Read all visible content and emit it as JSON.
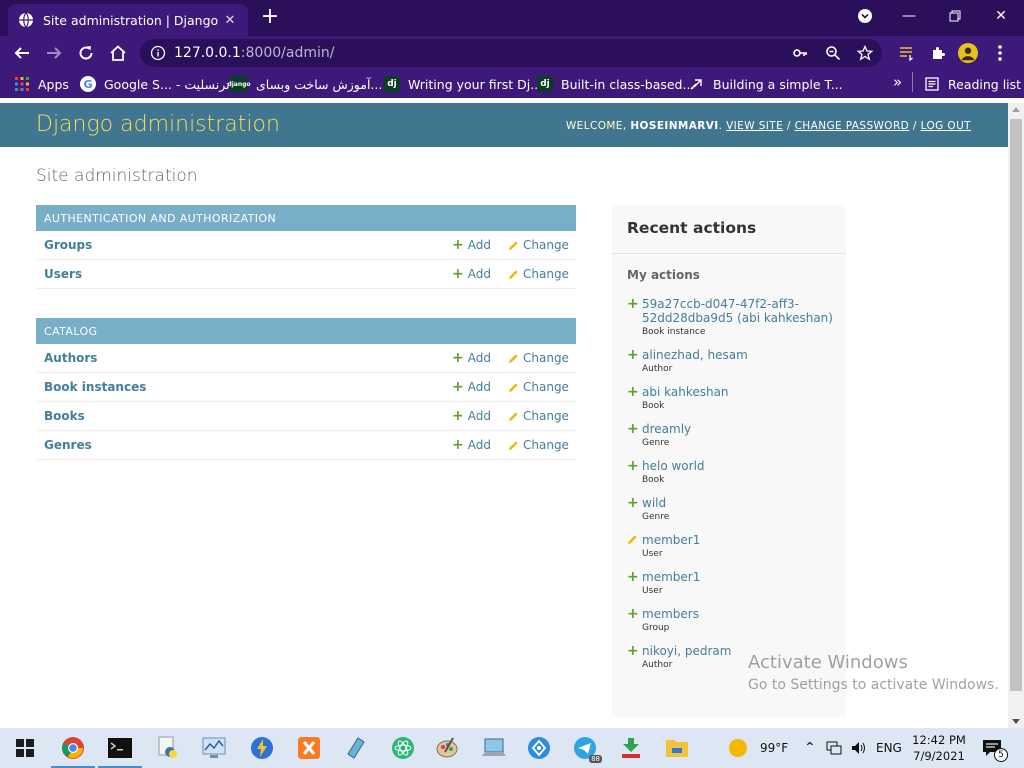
{
  "browser": {
    "tab_title": "Site administration | Django site admin",
    "url_host": "127.0.0.1",
    "url_rest": ":8000/admin/",
    "bookmarks": [
      {
        "label": "Apps",
        "icon": "apps-grid-icon"
      },
      {
        "label": "Google S... - ترنسليت",
        "icon": "google-icon"
      },
      {
        "label": "آموزش ساخت وبسای...",
        "icon": "django-icon"
      },
      {
        "label": "Writing your first Dj...",
        "icon": "dj-icon"
      },
      {
        "label": "Built-in class-based...",
        "icon": "dj-icon"
      },
      {
        "label": "Building a simple T...",
        "icon": "link-icon"
      }
    ],
    "bookmark_more": "»",
    "reading_list": "Reading list"
  },
  "header": {
    "branding": "Django administration",
    "welcome": "WELCOME,",
    "username": "HOSEINMARVI",
    "view_site": "VIEW SITE",
    "change_password": "CHANGE PASSWORD",
    "log_out": "LOG OUT",
    "sep": "/"
  },
  "main": {
    "title": "Site administration",
    "modules": [
      {
        "caption": "Authentication and Authorization",
        "models": [
          {
            "name": "Groups",
            "add": "Add",
            "change": "Change"
          },
          {
            "name": "Users",
            "add": "Add",
            "change": "Change"
          }
        ]
      },
      {
        "caption": "Catalog",
        "models": [
          {
            "name": "Authors",
            "add": "Add",
            "change": "Change"
          },
          {
            "name": "Book instances",
            "add": "Add",
            "change": "Change"
          },
          {
            "name": "Books",
            "add": "Add",
            "change": "Change"
          },
          {
            "name": "Genres",
            "add": "Add",
            "change": "Change"
          }
        ]
      }
    ]
  },
  "recent": {
    "title": "Recent actions",
    "subtitle": "My actions",
    "actions": [
      {
        "kind": "add",
        "name": "59a27ccb-d047-47f2-aff3-52dd28dba9d5 (abi kahkeshan)",
        "type": "Book instance"
      },
      {
        "kind": "add",
        "name": "alinezhad, hesam",
        "type": "Author"
      },
      {
        "kind": "add",
        "name": "abi kahkeshan",
        "type": "Book"
      },
      {
        "kind": "add",
        "name": "dreamly",
        "type": "Genre"
      },
      {
        "kind": "add",
        "name": "helo world",
        "type": "Book"
      },
      {
        "kind": "add",
        "name": "wild",
        "type": "Genre"
      },
      {
        "kind": "change",
        "name": "member1",
        "type": "User"
      },
      {
        "kind": "add",
        "name": "member1",
        "type": "User"
      },
      {
        "kind": "add",
        "name": "members",
        "type": "Group"
      },
      {
        "kind": "add",
        "name": "nikoyi, pedram",
        "type": "Author"
      }
    ]
  },
  "watermark": {
    "line1": "Activate Windows",
    "line2": "Go to Settings to activate Windows."
  },
  "taskbar": {
    "weather": "99°F",
    "lang": "ENG",
    "time": "12:42 PM",
    "date": "7/9/2021",
    "notifications": "5",
    "badge": "88"
  },
  "colors": {
    "django_header": "#417690",
    "django_caption": "#79aec8",
    "django_brand": "#f5dd5d",
    "link": "#447e9b",
    "add_green": "#5fa225",
    "chrome_dark": "#2b0f5a",
    "chrome_mid": "#3d1a7a"
  }
}
